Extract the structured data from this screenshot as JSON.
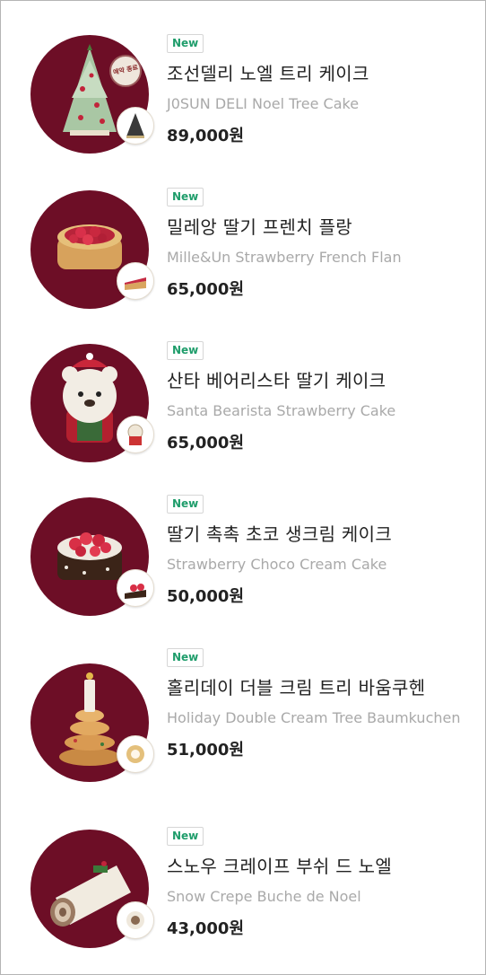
{
  "products": [
    {
      "badge": "New",
      "name_ko": "조선델리 노엘 트리 케이크",
      "name_en": "J0SUN DELI Noel Tree Cake",
      "price": "89,000원",
      "stamp_text": "예약 종료",
      "image": "christmas-tree-cake"
    },
    {
      "badge": "New",
      "name_ko": "밀레앙 딸기 프렌치 플랑",
      "name_en": "Mille&Un Strawberry French Flan",
      "price": "65,000원",
      "image": "strawberry-flan"
    },
    {
      "badge": "New",
      "name_ko": "산타 베어리스타 딸기 케이크",
      "name_en": "Santa Bearista Strawberry Cake",
      "price": "65,000원",
      "image": "santa-bear-cake"
    },
    {
      "badge": "New",
      "name_ko": "딸기 촉촉 초코 생크림 케이크",
      "name_en": "Strawberry Choco Cream Cake",
      "price": "50,000원",
      "image": "strawberry-choco-cake"
    },
    {
      "badge": "New",
      "name_ko": "홀리데이 더블 크림 트리 바움쿠헨",
      "name_en": "Holiday Double Cream Tree Baumkuchen",
      "price": "51,000원",
      "image": "baumkuchen-tree"
    },
    {
      "badge": "New",
      "name_ko": "스노우 크레이프 부쉬 드 노엘",
      "name_en": "Snow Crepe Buche de Noel",
      "price": "43,000원",
      "image": "buche-de-noel"
    }
  ],
  "colors": {
    "thumb_bg": "#6d0e26",
    "new_badge": "#1f9d6b",
    "title": "#222222",
    "subtitle": "#a9a9a9"
  }
}
